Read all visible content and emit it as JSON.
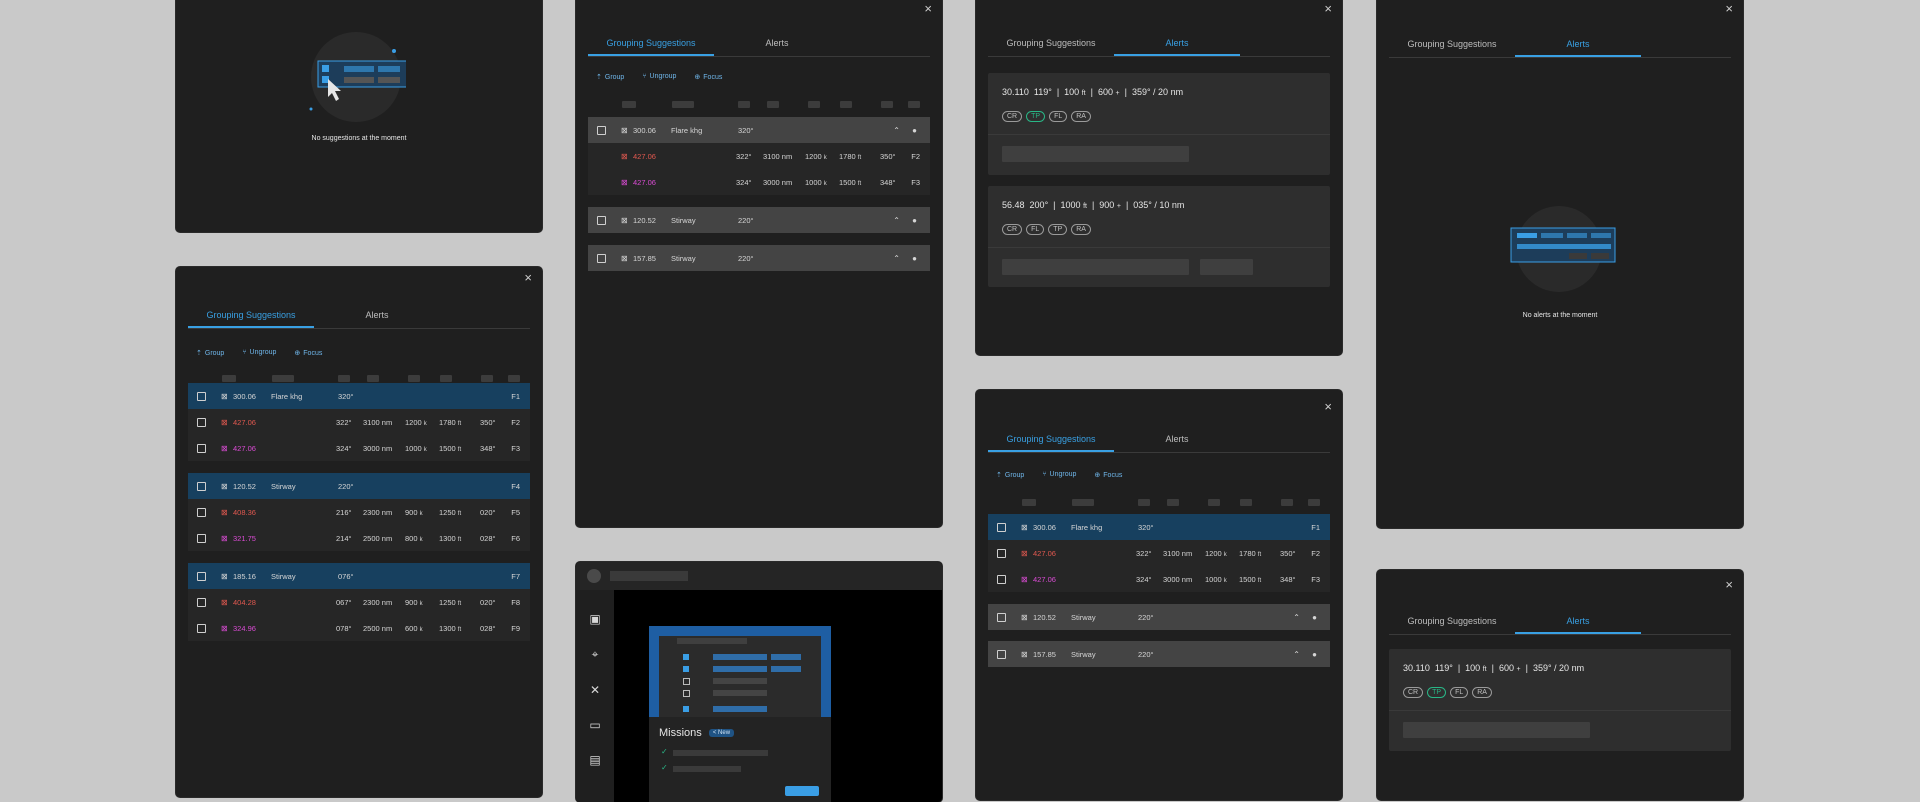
{
  "tabs": {
    "grouping": "Grouping Suggestions",
    "alerts": "Alerts"
  },
  "toolbar": {
    "group": "Group",
    "ungroup": "Ungroup",
    "focus": "Focus"
  },
  "close_icon": "×",
  "empty": {
    "suggestions": "No suggestions at the moment",
    "alerts": "No alerts at the moment"
  },
  "rows": {
    "flare_head": {
      "id": "300.06",
      "name": "Flare khg",
      "heading": "320°",
      "tag": "F1"
    },
    "flare_sub1": {
      "id": "427.06",
      "heading": "322°",
      "dist": "3100 nm",
      "alt": "1200",
      "alt_unit": "k",
      "alt2": "1780",
      "alt2_unit": "ft",
      "hdg2": "350°",
      "tag": "F2"
    },
    "flare_sub2": {
      "id": "427.06",
      "heading": "324°",
      "dist": "3000 nm",
      "alt": "1000",
      "alt_unit": "k",
      "alt2": "1500",
      "alt2_unit": "ft",
      "hdg2": "348°",
      "tag": "F3"
    },
    "stir1_head": {
      "id": "120.52",
      "name": "Stirway",
      "heading": "220°",
      "tag": "F4"
    },
    "stir1_sub1": {
      "id": "408.36",
      "heading": "216°",
      "dist": "2300 nm",
      "alt": "900",
      "alt_unit": "k",
      "alt2": "1250",
      "alt2_unit": "ft",
      "hdg2": "020°",
      "tag": "F5"
    },
    "stir1_sub2": {
      "id": "321.75",
      "heading": "214°",
      "dist": "2500 nm",
      "alt": "800",
      "alt_unit": "k",
      "alt2": "1300",
      "alt2_unit": "ft",
      "hdg2": "028°",
      "tag": "F6"
    },
    "stir2_head": {
      "id": "185.16",
      "name": "Stirway",
      "heading": "076°",
      "tag": "F7"
    },
    "stir2_sub1": {
      "id": "404.28",
      "heading": "067°",
      "dist": "2300 nm",
      "alt": "900",
      "alt_unit": "k",
      "alt2": "1250",
      "alt2_unit": "ft",
      "hdg2": "020°",
      "tag": "F8"
    },
    "stir2_sub2": {
      "id": "324.96",
      "heading": "078°",
      "dist": "2500 nm",
      "alt": "600",
      "alt_unit": "k",
      "alt2": "1300",
      "alt2_unit": "ft",
      "hdg2": "028°",
      "tag": "F9"
    },
    "stir3_head": {
      "id": "157.85",
      "name": "Stirway",
      "heading": "220°"
    }
  },
  "alert1": {
    "freq": "30.110",
    "hdg": "119°",
    "alt": "100",
    "alt_unit": "ft",
    "speed": "600",
    "speed_unit": "+",
    "bearing": "359° / 20 nm",
    "chips": [
      "CR",
      "TP",
      "FL",
      "RA"
    ]
  },
  "alert2": {
    "freq": "56.48",
    "hdg": "200°",
    "alt": "1000",
    "alt_unit": "ft",
    "speed": "900",
    "speed_unit": "+",
    "bearing": "035° / 10 nm",
    "chips": [
      "CR",
      "FL",
      "TP",
      "RA"
    ]
  },
  "missions": {
    "title": "Missions",
    "badge": "New"
  },
  "icons": {
    "close": "close-icon",
    "group": "group-icon",
    "ungroup": "ungroup-icon",
    "focus": "focus-icon",
    "plane": "aircraft-icon",
    "expand": "chevron-up-icon",
    "more": "dot-icon"
  }
}
